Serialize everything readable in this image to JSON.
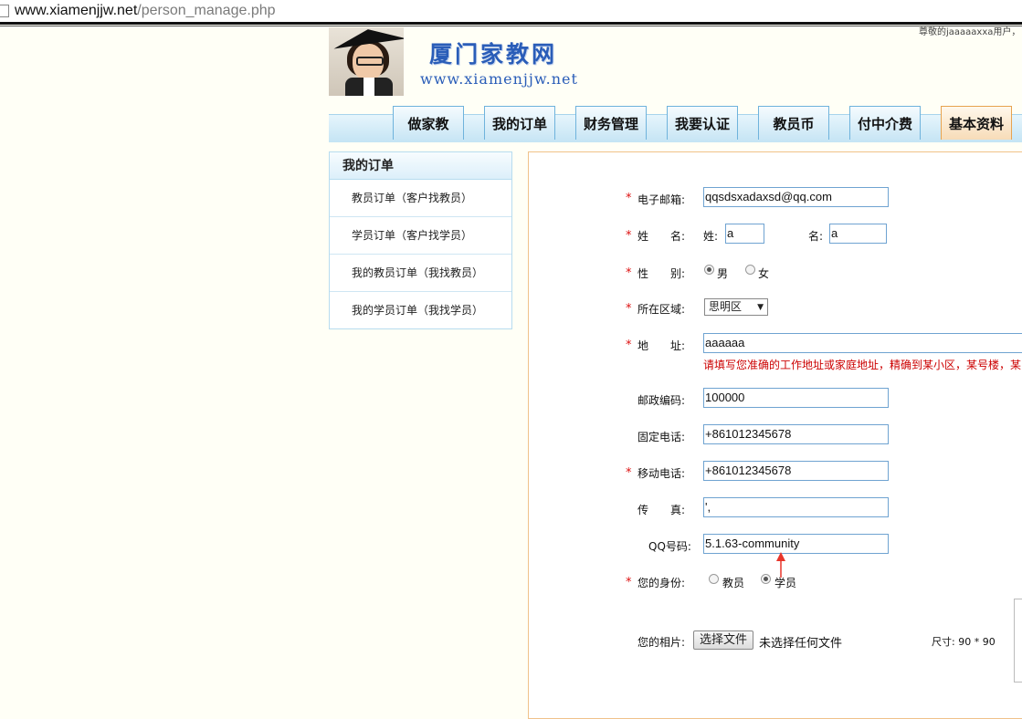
{
  "browser": {
    "url_host": "www.xiamenjjw.net",
    "url_path": "/person_manage.php"
  },
  "header": {
    "site_title": "厦门家教网",
    "site_url": "www.xiamenjjw.net",
    "top_note": "尊敬的jaaaaaxxa用户，"
  },
  "nav": {
    "tabs": [
      "做家教",
      "我的订单",
      "财务管理",
      "我要认证",
      "教员币",
      "付中介费",
      "基本资料"
    ],
    "active": "基本资料"
  },
  "sidebar": {
    "title": "我的订单",
    "items": [
      "教员订单（客户找教员）",
      "学员订单（客户找学员）",
      "我的教员订单（我找教员）",
      "我的学员订单（我找学员）"
    ]
  },
  "form": {
    "email": {
      "label": "电子邮箱:",
      "value": "qqsdsxadaxsd@qq.com",
      "required": true
    },
    "name": {
      "label": "姓　　名:",
      "surname_label": "姓:",
      "surname_value": "a",
      "given_label": "名:",
      "given_value": "a",
      "required": true
    },
    "gender": {
      "label": "性　　别:",
      "options": [
        "男",
        "女"
      ],
      "selected": "男",
      "required": true
    },
    "region": {
      "label": "所在区域:",
      "selected": "思明区",
      "required": true
    },
    "address": {
      "label": "地　　址:",
      "value": "aaaaaa",
      "hint": "请填写您准确的工作地址或家庭地址，精确到某小区，某号楼，某",
      "required": true
    },
    "postcode": {
      "label": "邮政编码:",
      "value": "100000"
    },
    "phone": {
      "label": "固定电话:",
      "value": "+861012345678"
    },
    "mobile": {
      "label": "移动电话:",
      "value": "+861012345678",
      "required": true
    },
    "fax": {
      "label": "传　　真:",
      "value": "',"
    },
    "qq": {
      "label": "QQ号码:",
      "value": "5.1.63-community"
    },
    "identity": {
      "label": "您的身份:",
      "options": [
        "教员",
        "学员"
      ],
      "selected": "学员",
      "required": true
    },
    "photo": {
      "label": "您的相片:",
      "button": "选择文件",
      "status": "未选择任何文件",
      "size_note": "尺寸: 90 * 90"
    }
  },
  "colors": {
    "link_blue": "#2a5db8",
    "required_red": "#d11111",
    "annotation_arrow": "#e8362b"
  }
}
